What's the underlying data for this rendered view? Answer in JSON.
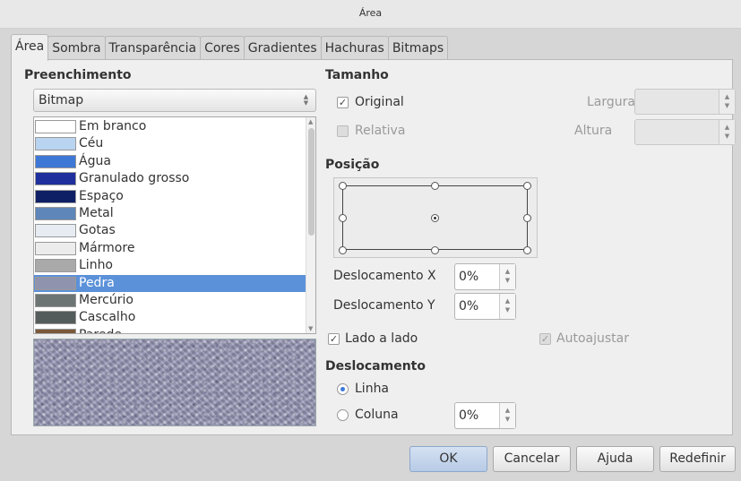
{
  "window": {
    "title": "Área"
  },
  "tabs": [
    "Área",
    "Sombra",
    "Transparência",
    "Cores",
    "Gradientes",
    "Hachuras",
    "Bitmaps"
  ],
  "fill": {
    "heading": "Preenchimento",
    "type_selected": "Bitmap",
    "items": [
      {
        "label": "Em branco",
        "color": "#ffffff"
      },
      {
        "label": "Céu",
        "color": "#b9d4f0"
      },
      {
        "label": "Água",
        "color": "#3e78d6"
      },
      {
        "label": "Granulado grosso",
        "color": "#1f2f9e"
      },
      {
        "label": "Espaço",
        "color": "#0f1f66"
      },
      {
        "label": "Metal",
        "color": "#5f86b8"
      },
      {
        "label": "Gotas",
        "color": "#e6ecf2"
      },
      {
        "label": "Mármore",
        "color": "#ececec"
      },
      {
        "label": "Linho",
        "color": "#a9a9a9"
      },
      {
        "label": "Pedra",
        "color": "#8f93ad"
      },
      {
        "label": "Mercúrio",
        "color": "#6d7474"
      },
      {
        "label": "Cascalho",
        "color": "#555c5c"
      },
      {
        "label": "Parede",
        "color": "#7a5a3a"
      }
    ],
    "selected_index": 9
  },
  "size": {
    "heading": "Tamanho",
    "original_label": "Original",
    "original_checked": true,
    "relative_label": "Relativa",
    "width_label": "Largura",
    "height_label": "Altura"
  },
  "position": {
    "heading": "Posição",
    "offset_x_label": "Deslocamento X",
    "offset_x_value": "0%",
    "offset_y_label": "Deslocamento Y",
    "offset_y_value": "0%",
    "tile_label": "Lado a lado",
    "autofit_label": "Autoajustar"
  },
  "offset": {
    "heading": "Deslocamento",
    "row_label": "Linha",
    "column_label": "Coluna",
    "value": "0%"
  },
  "buttons": {
    "ok": "OK",
    "cancel": "Cancelar",
    "help": "Ajuda",
    "reset": "Redefinir"
  }
}
